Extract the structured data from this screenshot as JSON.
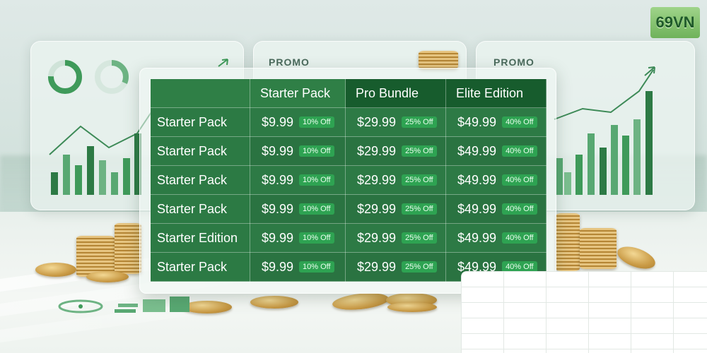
{
  "brand": {
    "logo_text": "69VN"
  },
  "panels": {
    "center_promo": "PROMO",
    "right_promo": "PROMO"
  },
  "table": {
    "headers": [
      "Starter Pack",
      "Pro Bundle",
      "Elite Edition"
    ],
    "rows": [
      {
        "label": "Starter Pack",
        "cells": [
          {
            "price": "$9.99",
            "badge": "10% Off"
          },
          {
            "price": "$29.99",
            "badge": "25% Off"
          },
          {
            "price": "$49.99",
            "badge": "40% Off"
          }
        ]
      },
      {
        "label": "Starter Pack",
        "cells": [
          {
            "price": "$9.99",
            "badge": "10% Off"
          },
          {
            "price": "$29.99",
            "badge": "25% Off"
          },
          {
            "price": "$49.99",
            "badge": "40% Off"
          }
        ]
      },
      {
        "label": "Starter Pack",
        "cells": [
          {
            "price": "$9.99",
            "badge": "10% Off"
          },
          {
            "price": "$29.99",
            "badge": "25% Off"
          },
          {
            "price": "$49.99",
            "badge": "40% Off"
          }
        ]
      },
      {
        "label": "Starter Pack",
        "cells": [
          {
            "price": "$9.99",
            "badge": "10% Off"
          },
          {
            "price": "$29.99",
            "badge": "25% Off"
          },
          {
            "price": "$49.99",
            "badge": "40% Off"
          }
        ]
      },
      {
        "label": "Starter Edition",
        "cells": [
          {
            "price": "$9.99",
            "badge": "10% Off"
          },
          {
            "price": "$29.99",
            "badge": "25% Off"
          },
          {
            "price": "$49.99",
            "badge": "40% Off"
          }
        ]
      },
      {
        "label": "Starter Pack",
        "cells": [
          {
            "price": "$9.99",
            "badge": "10% Off"
          },
          {
            "price": "$29.99",
            "badge": "25% Off"
          },
          {
            "price": "$49.99",
            "badge": "40% Off"
          }
        ]
      }
    ]
  },
  "colors": {
    "table_green": "#2c7a44",
    "header_dark": "#175c2d",
    "badge_green": "#2ea352",
    "chart_green": "#3f9a5a"
  }
}
